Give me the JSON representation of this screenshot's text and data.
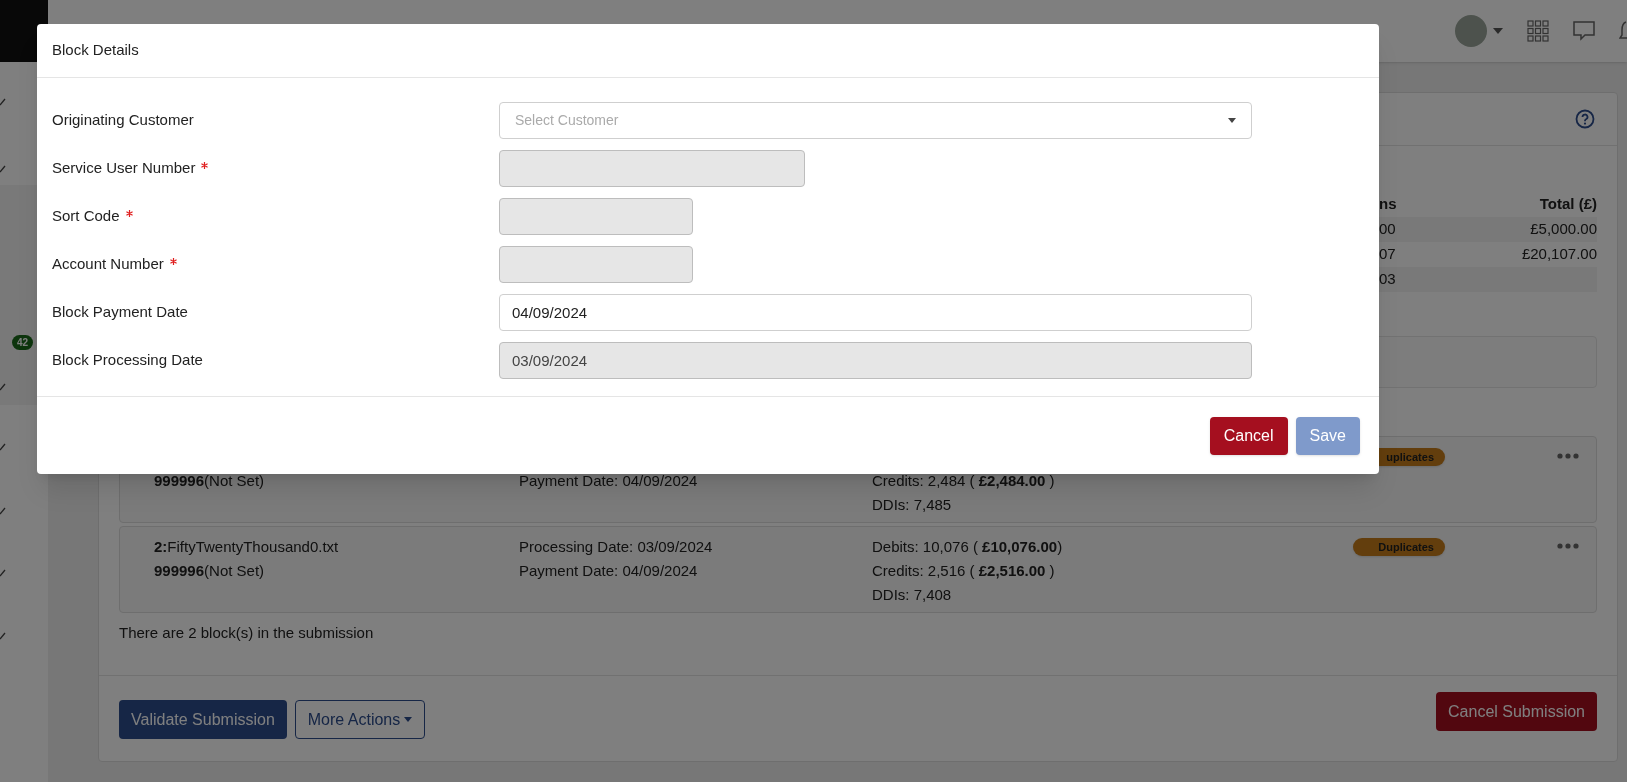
{
  "sidebar": {
    "badge": "42"
  },
  "panel": {
    "table": {
      "columns": [
        "ns",
        "Total (£)"
      ],
      "rows": [
        [
          "00",
          "£5,000.00"
        ],
        [
          "07",
          "£20,107.00"
        ],
        [
          "03"
        ]
      ]
    },
    "blocks": [
      {
        "sun": "**999996**(Not Set)",
        "payment_date": "Payment Date: 04/09/2024",
        "credits": "Credits: 2,484 ( **£2,484.00** )",
        "ddis": "DDIs: 7,485",
        "badge": "uplicates"
      },
      {
        "file": "**2:**FiftyTwentyThousand0.txt",
        "sun": "**999996**(Not Set)",
        "processing_date": "Processing Date: 03/09/2024",
        "payment_date": "Payment Date: 04/09/2024",
        "debits": "Debits: 10,076 ( **£10,076.00**)",
        "credits": "Credits: 2,516 ( **£2,516.00** )",
        "ddis": "DDIs: 7,408",
        "badge": "Duplicates"
      }
    ],
    "summary": "There are 2 block(s) in the submission",
    "actions": [
      {
        "label": "Validate Submission",
        "kind": "primary"
      },
      {
        "label": "More Actions",
        "kind": "dropdown"
      },
      {
        "label": "Cancel Submission",
        "kind": "danger"
      }
    ]
  },
  "modal": {
    "title": "Block Details",
    "fields": [
      {
        "label": "Originating Customer",
        "kind": "select",
        "required": false,
        "disabled": false,
        "placeholder": "Select Customer"
      },
      {
        "label": "Service User Number",
        "kind": "input",
        "required": true,
        "disabled": true
      },
      {
        "label": "Sort Code",
        "kind": "input",
        "required": true,
        "disabled": true
      },
      {
        "label": "Account Number",
        "kind": "input",
        "required": true,
        "disabled": true
      },
      {
        "label": "Block Payment Date",
        "kind": "input",
        "required": false,
        "disabled": false,
        "value": "04/09/2024"
      },
      {
        "label": "Block Processing Date",
        "kind": "input",
        "required": false,
        "disabled": true,
        "value": "03/09/2024"
      }
    ],
    "buttons": [
      {
        "label": "Cancel",
        "kind": "danger",
        "disabled": false
      },
      {
        "label": "Save",
        "kind": "primary",
        "disabled": true
      }
    ]
  }
}
